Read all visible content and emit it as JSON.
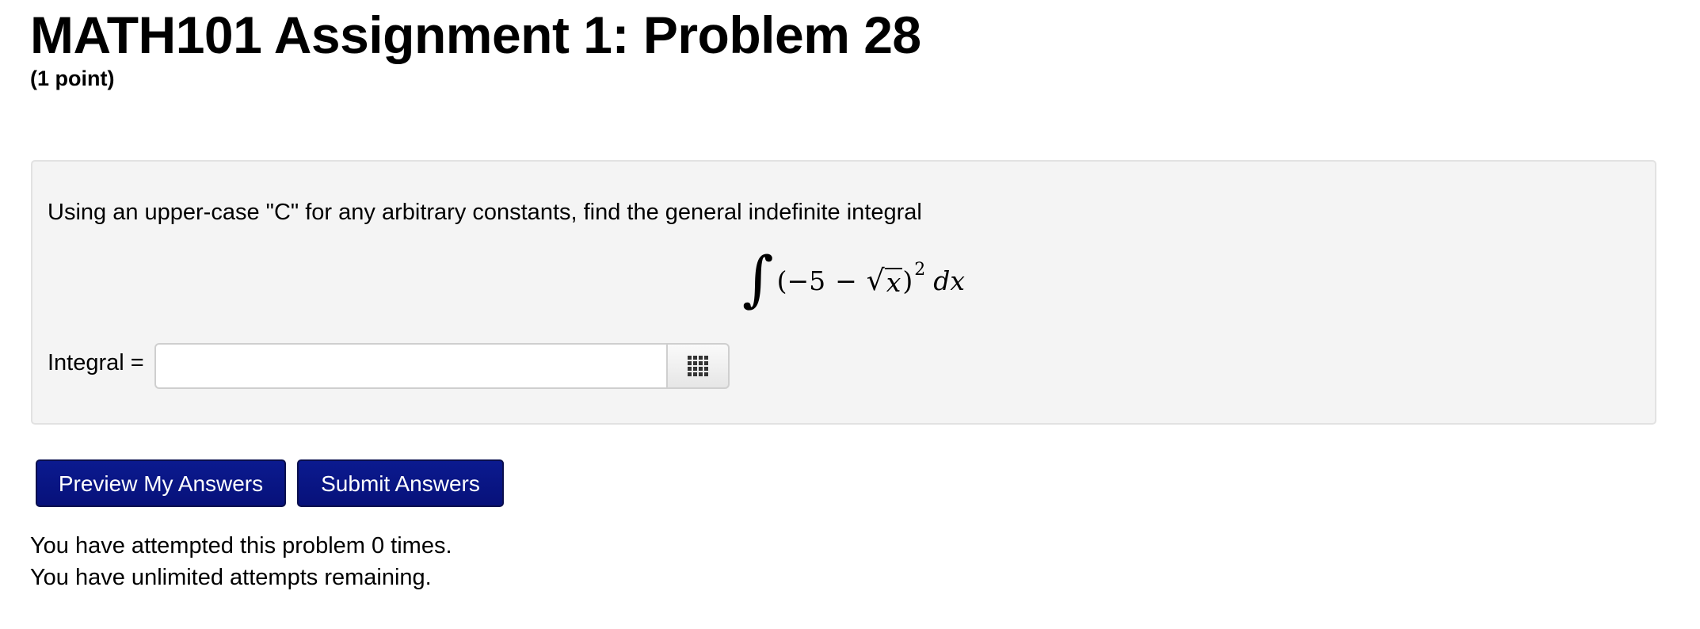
{
  "header": {
    "title": "MATH101 Assignment 1: Problem 28",
    "points": "(1 point)"
  },
  "problem": {
    "instructions": "Using an upper-case \"C\" for any arbitrary constants, find the general indefinite integral",
    "formula": {
      "integral_sign": "∫",
      "open_paren": "(",
      "constant": "−5",
      "operator": "−",
      "radical": "√",
      "radicand": "x",
      "close_paren": ")",
      "exponent": "2",
      "differential": "dx"
    },
    "answer_label": "Integral =",
    "answer_value": "",
    "answer_placeholder": "",
    "palette_icon": "grid-icon"
  },
  "actions": {
    "preview_label": "Preview My Answers",
    "submit_label": "Submit Answers",
    "button_color": "#0b1a8f"
  },
  "status": {
    "attempts": "You have attempted this problem 0 times.",
    "remaining": "You have unlimited attempts remaining."
  }
}
